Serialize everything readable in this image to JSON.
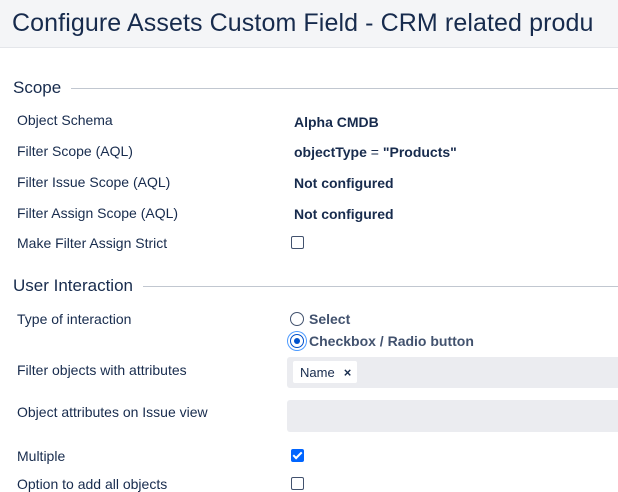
{
  "page": {
    "title": "Configure Assets Custom Field - CRM related produ"
  },
  "scope": {
    "section_title": "Scope",
    "object_schema": {
      "label": "Object Schema",
      "value": "Alpha CMDB"
    },
    "filter_scope": {
      "label": "Filter Scope (AQL)",
      "value_key": "objectType",
      "value_op": "=",
      "value_val": "\"Products\""
    },
    "filter_issue_scope": {
      "label": "Filter Issue Scope (AQL)",
      "value": "Not configured"
    },
    "filter_assign_scope": {
      "label": "Filter Assign Scope (AQL)",
      "value": "Not configured"
    },
    "make_filter_assign_strict": {
      "label": "Make Filter Assign Strict",
      "checked": false
    }
  },
  "user_interaction": {
    "section_title": "User Interaction",
    "type_of_interaction": {
      "label": "Type of interaction",
      "options": [
        {
          "label": "Select",
          "selected": false
        },
        {
          "label": "Checkbox / Radio button",
          "selected": true
        }
      ]
    },
    "filter_objects_with_attributes": {
      "label": "Filter objects with attributes",
      "tags": [
        {
          "label": "Name",
          "remove_symbol": "×"
        }
      ]
    },
    "object_attributes_on_issue_view": {
      "label": "Object attributes on Issue view",
      "tags": []
    },
    "multiple": {
      "label": "Multiple",
      "checked": true
    },
    "option_to_add_all_objects": {
      "label": "Option to add all objects",
      "checked": false
    }
  },
  "colors": {
    "accent": "#0065ff",
    "header_bg": "#f4f5f7",
    "field_bg": "#ebecf0",
    "text": "#172b4d"
  }
}
